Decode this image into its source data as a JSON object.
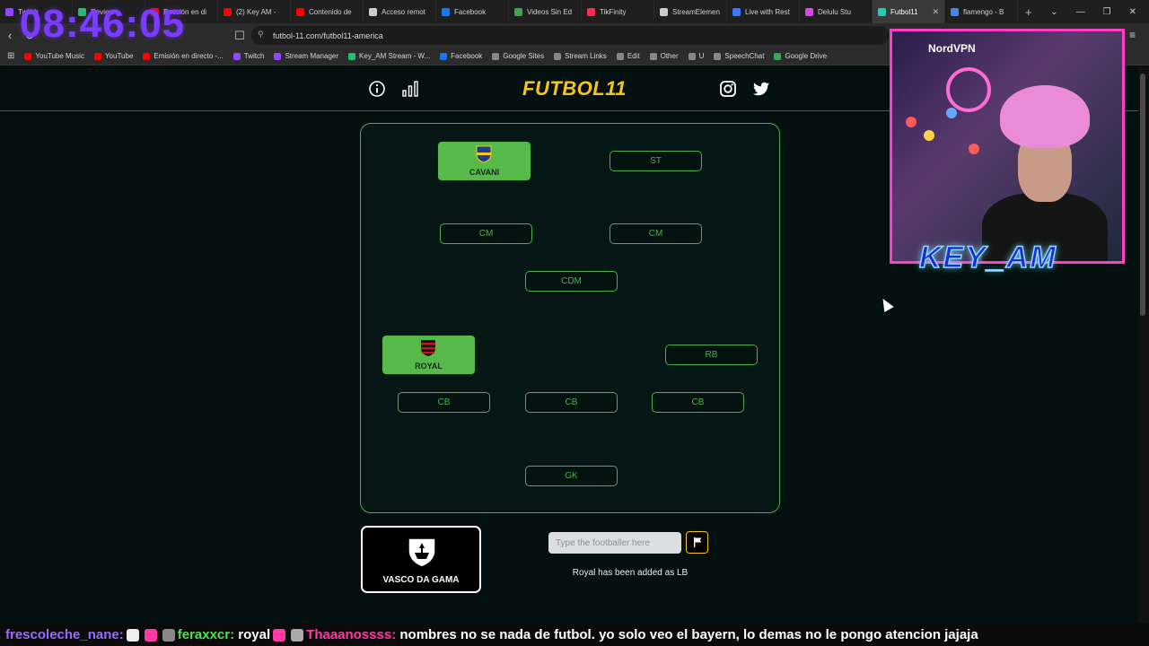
{
  "overlay": {
    "clock": "08:46:05",
    "streamer_name": "KEY_AM",
    "webcam_label": "NordVPN"
  },
  "browser": {
    "tabs": [
      {
        "label": "Twitch",
        "color": "#9146ff"
      },
      {
        "label": "Review",
        "color": "#20c070"
      },
      {
        "label": "Emisión en di",
        "color": "#ff0000"
      },
      {
        "label": "(2) Key AM -",
        "color": "#ff0000"
      },
      {
        "label": "Contenido de",
        "color": "#ff0000"
      },
      {
        "label": "Acceso remot",
        "color": "#cccccc"
      },
      {
        "label": "Facebook",
        "color": "#1877f2"
      },
      {
        "label": "Videos Sin Ed",
        "color": "#3ea64a"
      },
      {
        "label": "TikFinity",
        "color": "#ff2d55"
      },
      {
        "label": "StreamElemen",
        "color": "#cccccc"
      },
      {
        "label": "Live with Rest",
        "color": "#3a7bfd"
      },
      {
        "label": "Delulu Stu",
        "color": "#e040fb"
      },
      {
        "label": "Futbol11",
        "color": "#2ec4b6",
        "active": true
      },
      {
        "label": "flamengo - B",
        "color": "#4285f4"
      }
    ],
    "url": "futbol-11.com/futbol11-america",
    "bookmarks": [
      {
        "label": "YouTube Music",
        "color": "#ff0000"
      },
      {
        "label": "YouTube",
        "color": "#ff0000"
      },
      {
        "label": "Emisión en directo -...",
        "color": "#ff0000"
      },
      {
        "label": "Twitch",
        "color": "#9146ff"
      },
      {
        "label": "Stream Manager",
        "color": "#9146ff"
      },
      {
        "label": "Key_AM Stream - W...",
        "color": "#20c070"
      },
      {
        "label": "Facebook",
        "color": "#1877f2"
      },
      {
        "label": "Google Sites",
        "color": "#888888"
      },
      {
        "label": "Stream Links",
        "color": "#888888"
      },
      {
        "label": "Edit",
        "color": "#888888"
      },
      {
        "label": "Other",
        "color": "#888888"
      },
      {
        "label": "U",
        "color": "#888888"
      },
      {
        "label": "SpeechChat",
        "color": "#888888"
      },
      {
        "label": "Google Drive",
        "color": "#34a853"
      }
    ]
  },
  "site": {
    "logo": "FUTBOL11"
  },
  "pitch": {
    "filled": [
      {
        "player": "CAVANI",
        "club_color": "#1a3d8f"
      },
      {
        "player": "ROYAL",
        "club_color": "#c4161c"
      }
    ],
    "slots": [
      "ST",
      "CM",
      "CM",
      "CDM",
      "RB",
      "CB",
      "CB",
      "CB",
      "GK"
    ]
  },
  "club": {
    "name": "VASCO DA GAMA"
  },
  "guess": {
    "placeholder": "Type the footballer here",
    "status": "Royal has been added as LB"
  },
  "chat": {
    "user1": "frescoleche_nane:",
    "user2": "feraxxcr:",
    "msg2": "royal",
    "user3": "Thaaanossss:",
    "msg3": "nombres no se nada de futbol. yo solo veo el bayern, lo demas no le pongo atencion jajaja"
  }
}
